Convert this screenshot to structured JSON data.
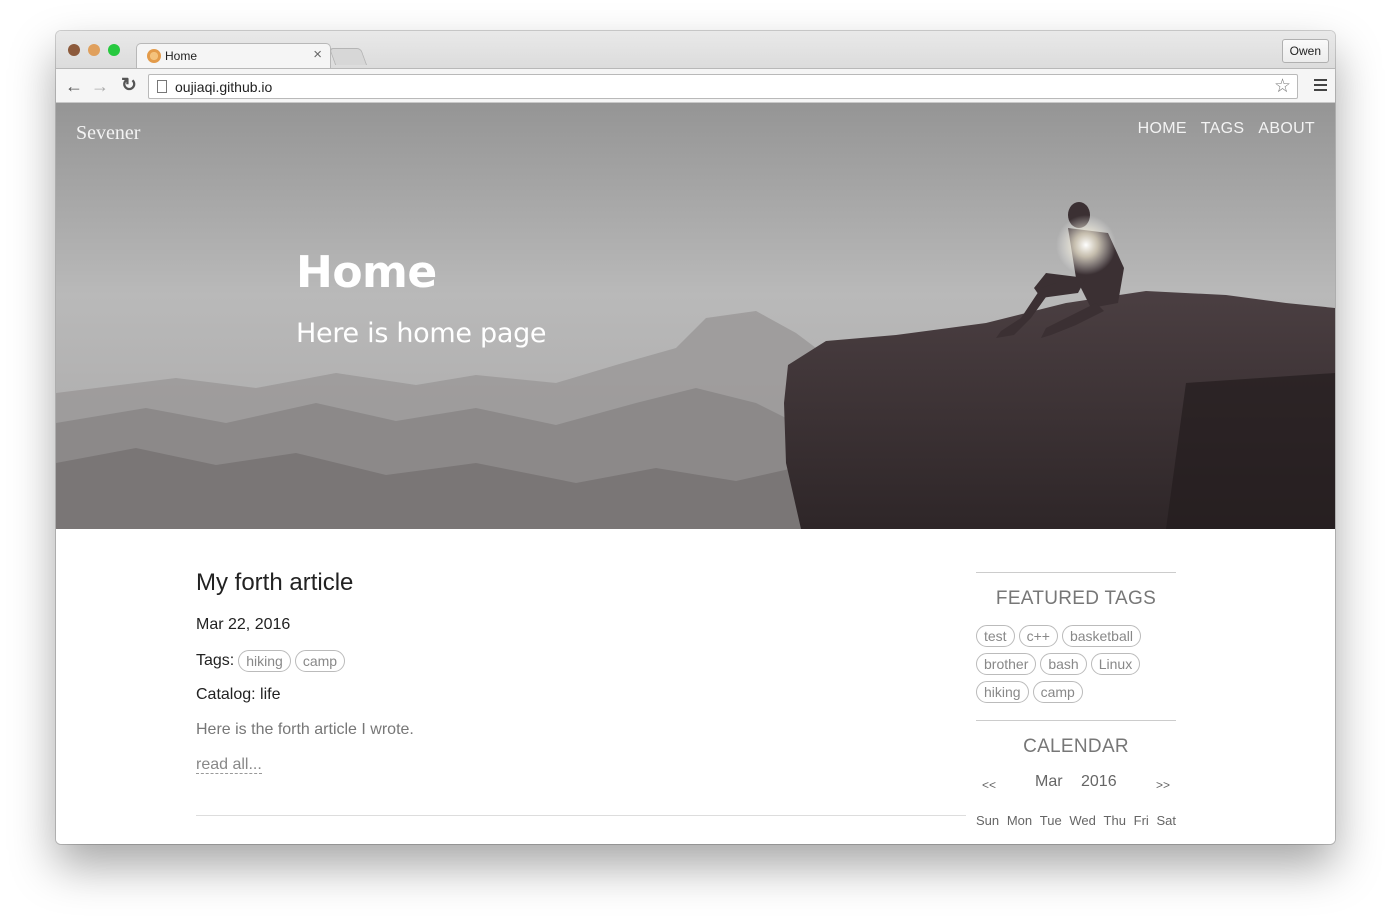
{
  "browser": {
    "tab_title": "Home",
    "tab_close": "×",
    "profile_name": "Owen",
    "url": "oujiaqi.github.io"
  },
  "site": {
    "brand": "Sevener",
    "nav": [
      "HOME",
      "TAGS",
      "ABOUT"
    ],
    "hero_title": "Home",
    "hero_subtitle": "Here is home page"
  },
  "article": {
    "title": "My forth article",
    "date": "Mar 22, 2016",
    "tags_label": "Tags:",
    "tags": [
      "hiking",
      "camp"
    ],
    "catalog": "Catalog: life",
    "excerpt": "Here is the forth article I wrote.",
    "read_all": "read all..."
  },
  "sidebar": {
    "featured_heading": "FEATURED TAGS",
    "featured_tags": [
      "test",
      "c++",
      "basketball",
      "brother",
      "bash",
      "Linux",
      "hiking",
      "camp"
    ],
    "calendar_heading": "CALENDAR",
    "calendar": {
      "prev": "<<",
      "next": ">>",
      "month": "Mar",
      "year": "2016",
      "weekdays": [
        "Sun",
        "Mon",
        "Tue",
        "Wed",
        "Thu",
        "Fri",
        "Sat"
      ]
    }
  }
}
